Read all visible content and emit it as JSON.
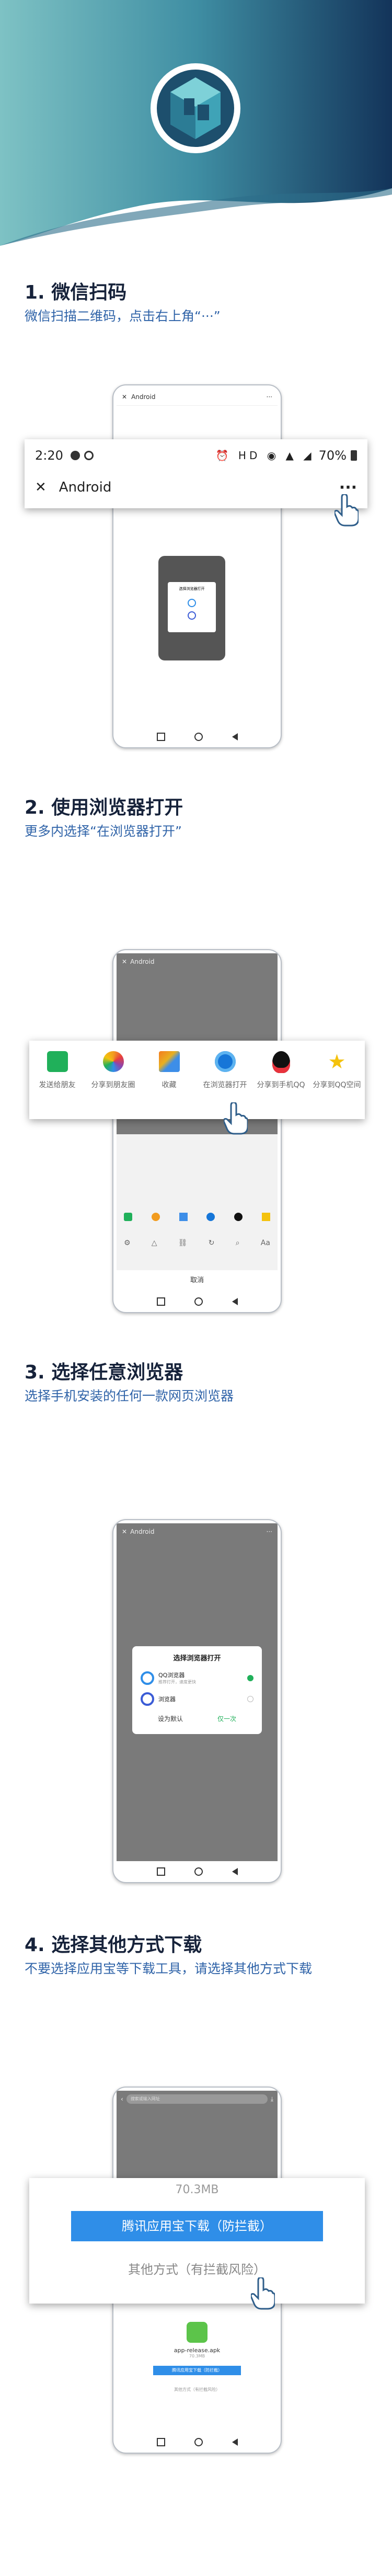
{
  "hero": {
    "logo": "cube-logo"
  },
  "step1": {
    "title": "1. 微信扫码",
    "subtitle": "微信扫描二维码，点击右上角“···”",
    "status_time": "2:20",
    "status_battery": "70%",
    "header_title": "Android",
    "more_glyph": "···",
    "close_glyph": "✕",
    "mini_header": "Android",
    "mini_card_title": "选择浏览器打开"
  },
  "step2": {
    "title": "2. 使用浏览器打开",
    "subtitle": "更多内选择“在浏览器打开”",
    "header_title": "Android",
    "share_items": [
      {
        "label": "发送给朋友",
        "icon": "send-icon",
        "color": "#20b05a"
      },
      {
        "label": "分享到朋友圈",
        "icon": "moments-icon",
        "color": "#f29c1f"
      },
      {
        "label": "收藏",
        "icon": "cube-icon",
        "color": "#3d8ee8"
      },
      {
        "label": "在浏览器打开",
        "icon": "browser-icon",
        "color": "#1676d8"
      },
      {
        "label": "分享到手机QQ",
        "icon": "qq-icon",
        "color": "#111111"
      },
      {
        "label": "分享到QQ空间",
        "icon": "qzone-icon",
        "color": "#f4c20d"
      }
    ],
    "cancel": "取消"
  },
  "step3": {
    "title": "3. 选择任意浏览器",
    "subtitle": "选择手机安装的任何一款网页浏览器",
    "header_title": "Android",
    "dialog_title": "选择浏览器打开",
    "browsers": [
      {
        "name": "QQ浏览器",
        "desc": "推荐打开，速度更快",
        "selected": true
      },
      {
        "name": "浏览器",
        "desc": "",
        "selected": false
      }
    ],
    "set_default": "设为默认",
    "only_once": "仅一次"
  },
  "step4": {
    "title": "4. 选择其他方式下载",
    "subtitle": "不要选择应用宝等下载工具，请选择其他方式下载",
    "search_placeholder": "搜索或输入网址",
    "size": "70.3MB",
    "primary_btn": "腾讯应用宝下载（防拦截）",
    "secondary_btn": "其他方式（有拦截风险）",
    "apk_name": "app-release.apk",
    "apk_size": "70.3MB",
    "mini_primary": "腾讯应用宝下载（防拦截）",
    "mini_secondary": "其他方式（有拦截风险）",
    "back": "‹"
  }
}
